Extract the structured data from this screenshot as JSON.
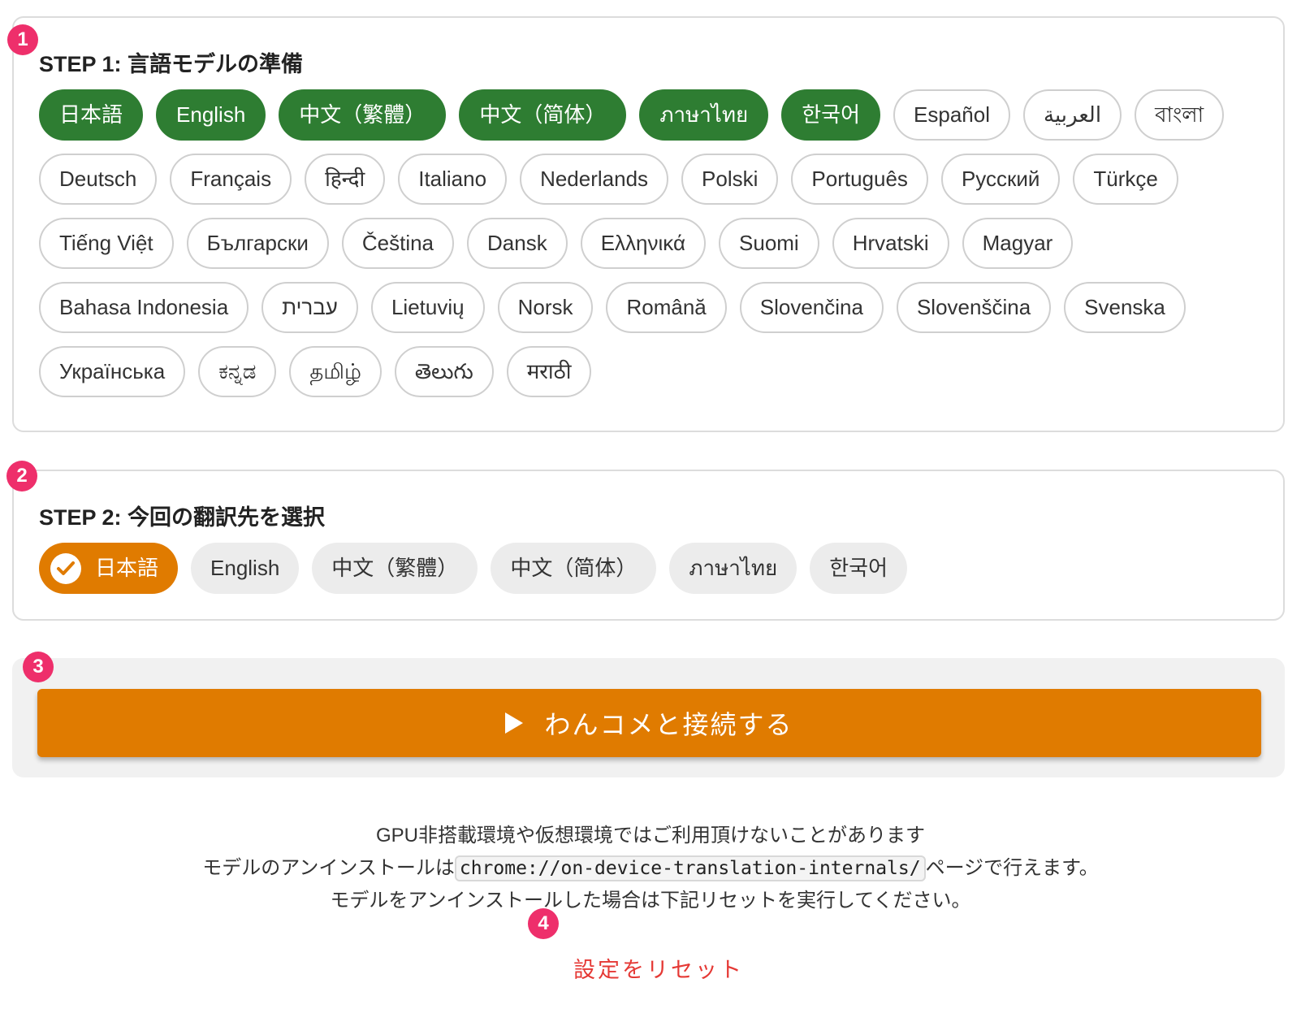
{
  "step1": {
    "badge": "1",
    "title": "STEP 1: 言語モデルの準備",
    "languages": [
      {
        "label": "日本語",
        "prepared": true
      },
      {
        "label": "English",
        "prepared": true
      },
      {
        "label": "中文（繁體）",
        "prepared": true
      },
      {
        "label": "中文（简体）",
        "prepared": true
      },
      {
        "label": "ภาษาไทย",
        "prepared": true
      },
      {
        "label": "한국어",
        "prepared": true
      },
      {
        "label": "Español",
        "prepared": false
      },
      {
        "label": "العربية",
        "prepared": false
      },
      {
        "label": "বাংলা",
        "prepared": false
      },
      {
        "label": "Deutsch",
        "prepared": false
      },
      {
        "label": "Français",
        "prepared": false
      },
      {
        "label": "हिन्दी",
        "prepared": false
      },
      {
        "label": "Italiano",
        "prepared": false
      },
      {
        "label": "Nederlands",
        "prepared": false
      },
      {
        "label": "Polski",
        "prepared": false
      },
      {
        "label": "Português",
        "prepared": false
      },
      {
        "label": "Русский",
        "prepared": false
      },
      {
        "label": "Türkçe",
        "prepared": false
      },
      {
        "label": "Tiếng Việt",
        "prepared": false
      },
      {
        "label": "Български",
        "prepared": false
      },
      {
        "label": "Čeština",
        "prepared": false
      },
      {
        "label": "Dansk",
        "prepared": false
      },
      {
        "label": "Ελληνικά",
        "prepared": false
      },
      {
        "label": "Suomi",
        "prepared": false
      },
      {
        "label": "Hrvatski",
        "prepared": false
      },
      {
        "label": "Magyar",
        "prepared": false
      },
      {
        "label": "Bahasa Indonesia",
        "prepared": false
      },
      {
        "label": "עברית",
        "prepared": false
      },
      {
        "label": "Lietuvių",
        "prepared": false
      },
      {
        "label": "Norsk",
        "prepared": false
      },
      {
        "label": "Română",
        "prepared": false
      },
      {
        "label": "Slovenčina",
        "prepared": false
      },
      {
        "label": "Slovenščina",
        "prepared": false
      },
      {
        "label": "Svenska",
        "prepared": false
      },
      {
        "label": "Українська",
        "prepared": false
      },
      {
        "label": "ಕನ್ನಡ",
        "prepared": false
      },
      {
        "label": "தமிழ்",
        "prepared": false
      },
      {
        "label": "తెలుగు",
        "prepared": false
      },
      {
        "label": "मराठी",
        "prepared": false
      }
    ]
  },
  "step2": {
    "badge": "2",
    "title": "STEP 2: 今回の翻訳先を選択",
    "targets": [
      {
        "label": "日本語",
        "selected": true
      },
      {
        "label": "English",
        "selected": false
      },
      {
        "label": "中文（繁體）",
        "selected": false
      },
      {
        "label": "中文（简体）",
        "selected": false
      },
      {
        "label": "ภาษาไทย",
        "selected": false
      },
      {
        "label": "한국어",
        "selected": false
      }
    ]
  },
  "step3": {
    "badge": "3",
    "connect_label": "わんコメと接続する",
    "icon": "play-icon"
  },
  "notes": {
    "line1": "GPU非搭載環境や仮想環境ではご利用頂けないことがあります",
    "line2_prefix": "モデルのアンインストールは",
    "line2_code": "chrome://on-device-translation-internals/",
    "line2_suffix": "ページで行えます。",
    "line3": "モデルをアンインストールした場合は下記リセットを実行してください。"
  },
  "reset": {
    "badge": "4",
    "label": "設定をリセット"
  },
  "colors": {
    "prepared_green": "#2e7d32",
    "accent_orange": "#e07b00",
    "badge_pink": "#ee2f6b",
    "reset_red": "#e53935"
  }
}
